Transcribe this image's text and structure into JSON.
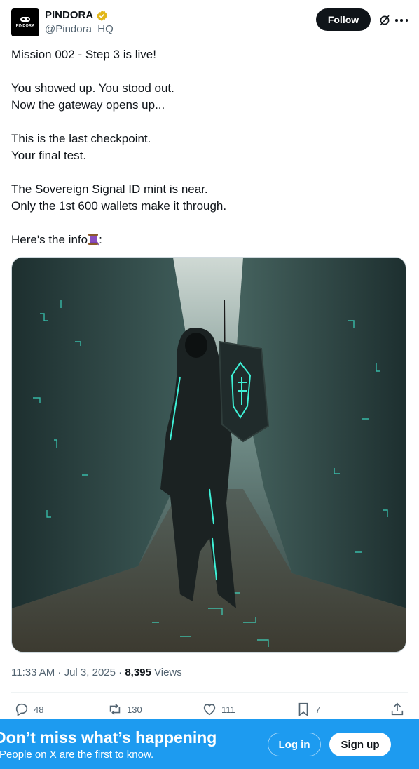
{
  "author": {
    "display_name": "PINDORA",
    "handle": "@Pindora_HQ",
    "avatar_text": "PINDORA",
    "verified": true
  },
  "header": {
    "follow_label": "Follow"
  },
  "tweet": {
    "lines": [
      "Mission 002 - Step 3 is live!",
      "",
      "You showed up. You stood out.",
      "Now the gateway opens up...",
      "",
      "This is the last checkpoint.",
      "Your final test.",
      "",
      "The Sovereign Signal ID mint is near.",
      "Only the 1st 600 wallets make it through.",
      ""
    ],
    "info_prefix": "Here's the info",
    "info_suffix": ":"
  },
  "meta": {
    "time_date": "11:33 AM · Jul 3, 2025 · ",
    "views_count": "8,395",
    "views_label": " Views"
  },
  "actions": {
    "replies": "48",
    "reposts": "130",
    "likes": "111",
    "bookmarks": "7"
  },
  "icons": [
    "verified-badge-icon",
    "grok-icon",
    "more-icon",
    "reply-icon",
    "repost-icon",
    "like-icon",
    "bookmark-icon",
    "share-icon",
    "spool-emoji-icon"
  ],
  "banner": {
    "title": "Don’t miss what’s happening",
    "subtitle": "People on X are the first to know.",
    "login_label": "Log in",
    "signup_label": "Sign up"
  },
  "colors": {
    "accent": "#1d9bf0",
    "text": "#0f1419",
    "secondary": "#536471",
    "glow": "#3ef0d6"
  }
}
